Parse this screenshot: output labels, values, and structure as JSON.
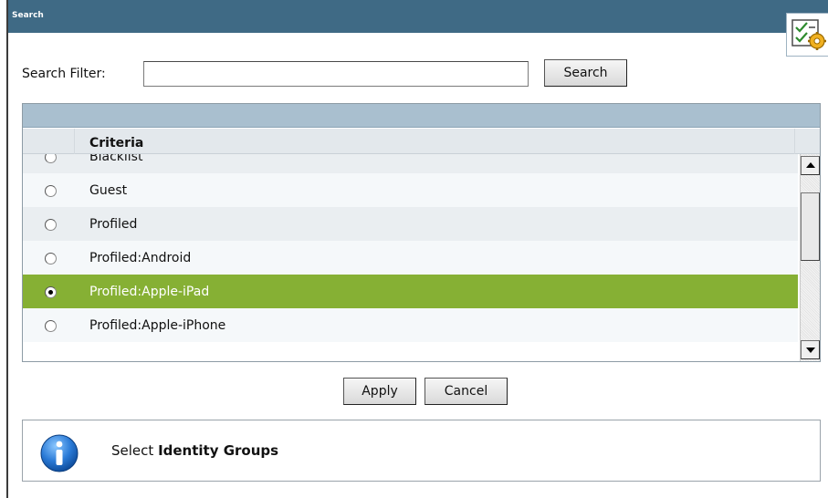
{
  "window": {
    "title": "Search"
  },
  "filter": {
    "label": "Search Filter:",
    "value": "",
    "placeholder": ""
  },
  "buttons": {
    "search": "Search",
    "apply": "Apply",
    "cancel": "Cancel"
  },
  "grid": {
    "column_header": "Criteria",
    "rows": [
      {
        "label": "Blacklist",
        "selected": false
      },
      {
        "label": "Guest",
        "selected": false
      },
      {
        "label": "Profiled",
        "selected": false
      },
      {
        "label": "Profiled:Android",
        "selected": false
      },
      {
        "label": "Profiled:Apple-iPad",
        "selected": true
      },
      {
        "label": "Profiled:Apple-iPhone",
        "selected": false
      }
    ]
  },
  "info": {
    "prefix": "Select",
    "emphasis": "Identity Groups",
    "icon": "info-icon"
  },
  "icons": {
    "settings": "checklist-gear-icon",
    "scroll_up": "arrow-up-icon",
    "scroll_down": "arrow-down-icon"
  },
  "colors": {
    "titlebar": "#3f6a85",
    "grid_topbar": "#a9bfcf",
    "selected_row": "#86b034"
  }
}
